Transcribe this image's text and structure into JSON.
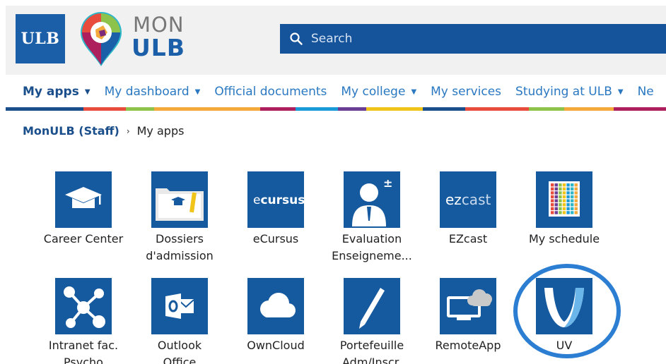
{
  "header": {
    "ulb_box_text": "ULB",
    "logo_top": "MON",
    "logo_bottom": "ULB",
    "search_placeholder": "Search"
  },
  "nav": {
    "items": [
      {
        "label": "My apps",
        "active": true
      },
      {
        "label": "My dashboard"
      },
      {
        "label": "Official documents"
      },
      {
        "label": "My college"
      },
      {
        "label": "My services"
      },
      {
        "label": "Studying at ULB"
      },
      {
        "label": "Ne"
      }
    ],
    "stripe_colors": [
      "#1b4f8c",
      "#e84c3d",
      "#8dc34a",
      "#f3a93c",
      "#ad1f5d",
      "#1a9bd7",
      "#6b3e96",
      "#f0c419"
    ]
  },
  "breadcrumb": {
    "root": "MonULB (Staff)",
    "separator": "›",
    "current": "My apps"
  },
  "apps": [
    {
      "label_1": "Career Center",
      "label_2": ""
    },
    {
      "label_1": "Dossiers",
      "label_2": "d'admission"
    },
    {
      "label_1": "eCursus",
      "label_2": "",
      "tile_text_a": "e",
      "tile_text_b": "cursus"
    },
    {
      "label_1": "Evaluation",
      "label_2": "Enseigneme..."
    },
    {
      "label_1": "EZcast",
      "label_2": "",
      "tile_text_a": "ez",
      "tile_text_b": "cast"
    },
    {
      "label_1": "My schedule",
      "label_2": ""
    },
    {
      "label_1": "Intranet fac.",
      "label_2": "Psycho"
    },
    {
      "label_1": "Outlook",
      "label_2": "Office"
    },
    {
      "label_1": "OwnCloud",
      "label_2": ""
    },
    {
      "label_1": "Portefeuille",
      "label_2": "Adm/Inscr."
    },
    {
      "label_1": "RemoteApp",
      "label_2": ""
    },
    {
      "label_1": "UV",
      "label_2": ""
    }
  ],
  "colors": {
    "brand_blue": "#15599e",
    "nav_link": "#2a78c1",
    "highlight_ring": "#2b7ed2"
  }
}
